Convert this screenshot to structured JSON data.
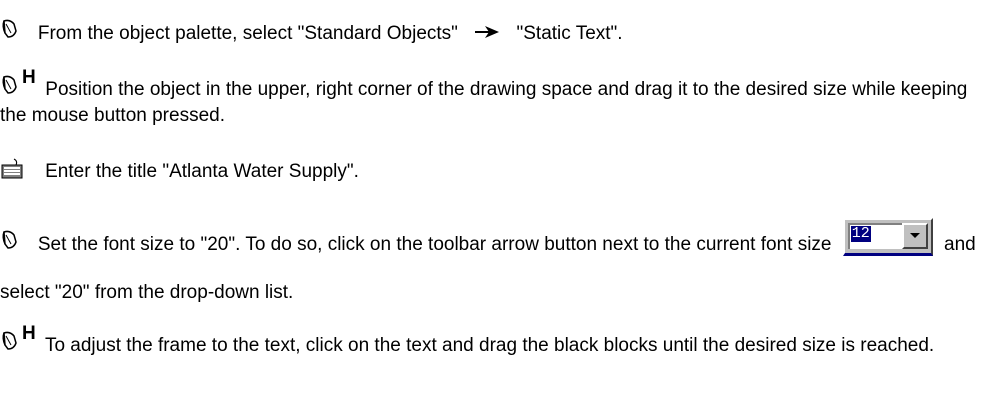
{
  "steps": [
    {
      "icon": "mouse-click-icon",
      "text_before": "From the object palette, select \"Standard Objects\"",
      "text_after": "\"Static Text\"."
    },
    {
      "icon": "mouse-hold-icon",
      "icon_letter": "H",
      "text": "Position the object in the upper, right corner of the drawing space and drag it to the desired size while keeping the mouse button pressed."
    },
    {
      "icon": "keyboard-icon",
      "text": "Enter the title \"Atlanta Water Supply\"."
    },
    {
      "icon": "mouse-click-icon",
      "text_before": "Set the font size to \"20\". To do so, click on the toolbar arrow button next to the current font size",
      "font_size_value": "12",
      "text_after": "and select \"20\" from the drop-down list."
    },
    {
      "icon": "mouse-hold-icon",
      "icon_letter": "H",
      "text": "To adjust the frame to the text, click on the text and drag the black blocks until the desired size is reached."
    }
  ]
}
